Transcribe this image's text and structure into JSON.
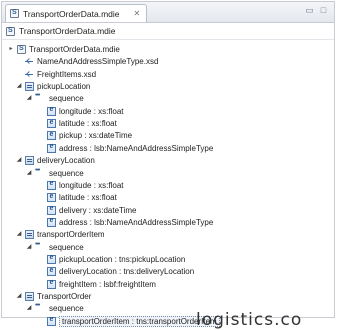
{
  "tab": {
    "title": "TransportOrderData.mdie",
    "close_glyph": "✕"
  },
  "window_controls": {
    "minimize": "▭",
    "maximize": "□"
  },
  "breadcrumb": {
    "label": "TransportOrderData.mdie"
  },
  "tree": [
    {
      "level": 0,
      "twisty": "▸",
      "icon": "schema-file-icon",
      "label": "TransportOrderData.mdie"
    },
    {
      "level": 1,
      "twisty": "",
      "icon": "import-icon",
      "label": "NameAndAddressSimpleType.xsd"
    },
    {
      "level": 1,
      "twisty": "",
      "icon": "import-icon",
      "label": "FreightItems.xsd"
    },
    {
      "level": 1,
      "twisty": "◢",
      "icon": "complex-type-icon",
      "label": "pickupLocation"
    },
    {
      "level": 2,
      "twisty": "◢",
      "icon": "sequence-icon",
      "label": "sequence"
    },
    {
      "level": 3,
      "twisty": "",
      "icon": "element-icon",
      "label": "longitude : xs:float"
    },
    {
      "level": 3,
      "twisty": "",
      "icon": "element-icon",
      "label": "latitude : xs:float"
    },
    {
      "level": 3,
      "twisty": "",
      "icon": "element-icon",
      "label": "pickup : xs:dateTime"
    },
    {
      "level": 3,
      "twisty": "",
      "icon": "element-icon",
      "label": "address : lsb:NameAndAddressSimpleType"
    },
    {
      "level": 1,
      "twisty": "◢",
      "icon": "complex-type-icon",
      "label": "deliveryLocation"
    },
    {
      "level": 2,
      "twisty": "◢",
      "icon": "sequence-icon",
      "label": "sequence"
    },
    {
      "level": 3,
      "twisty": "",
      "icon": "element-icon",
      "label": "longitude : xs:float"
    },
    {
      "level": 3,
      "twisty": "",
      "icon": "element-icon",
      "label": "latitude : xs:float"
    },
    {
      "level": 3,
      "twisty": "",
      "icon": "element-icon",
      "label": "delivery : xs:dateTime"
    },
    {
      "level": 3,
      "twisty": "",
      "icon": "element-icon",
      "label": "address : lsb:NameAndAddressSimpleType"
    },
    {
      "level": 1,
      "twisty": "◢",
      "icon": "complex-type-icon",
      "label": "transportOrderItem"
    },
    {
      "level": 2,
      "twisty": "◢",
      "icon": "sequence-icon",
      "label": "sequence"
    },
    {
      "level": 3,
      "twisty": "",
      "icon": "element-icon",
      "label": "pickupLocation : tns:pickupLocation"
    },
    {
      "level": 3,
      "twisty": "",
      "icon": "element-icon",
      "label": "deliveryLocation : tns:deliveryLocation"
    },
    {
      "level": 3,
      "twisty": "",
      "icon": "element-icon",
      "label": "freightItem : lsbf:freightItem"
    },
    {
      "level": 1,
      "twisty": "◢",
      "icon": "complex-type-icon",
      "label": "TransportOrder"
    },
    {
      "level": 2,
      "twisty": "◢",
      "icon": "sequence-icon",
      "label": "sequence"
    },
    {
      "level": 3,
      "twisty": "",
      "icon": "element-icon",
      "label": "transportOrderItem : tns:transportOrderItem",
      "selected": true
    }
  ],
  "footer_text": "logistics.co"
}
